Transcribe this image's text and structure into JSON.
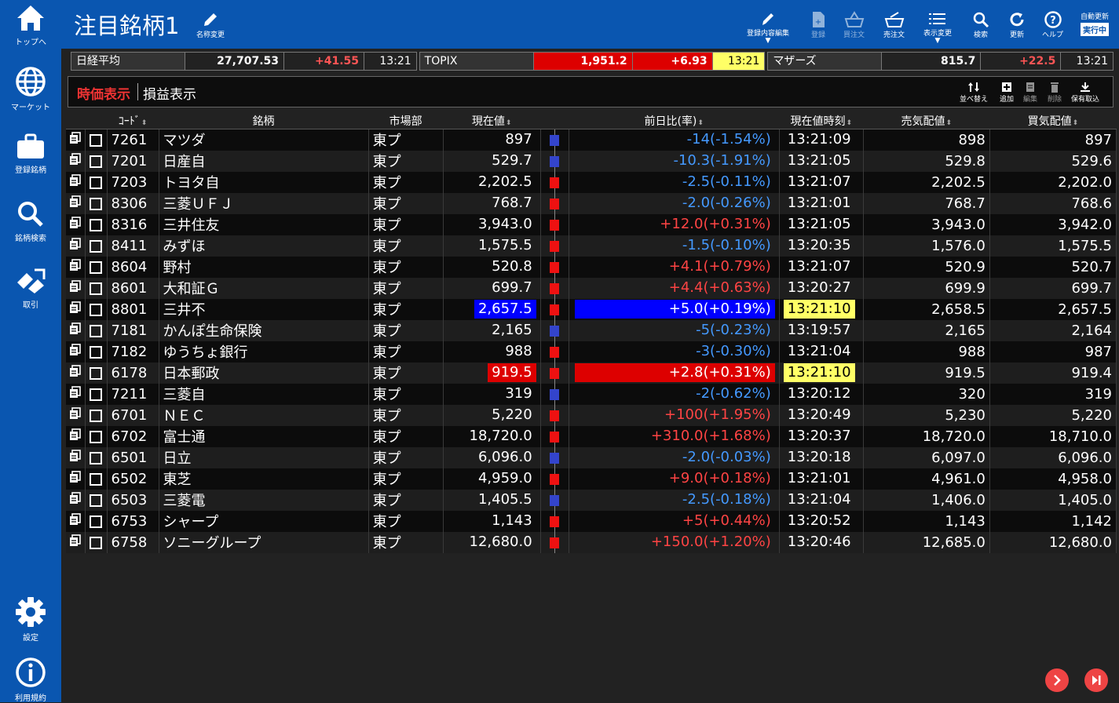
{
  "sidebar": {
    "items": [
      {
        "label": "トップへ",
        "icon": "home-icon"
      },
      {
        "label": "マーケット",
        "icon": "globe-icon"
      },
      {
        "label": "登録銘柄",
        "icon": "briefcase-icon"
      },
      {
        "label": "銘柄検索",
        "icon": "search-icon"
      },
      {
        "label": "取引",
        "icon": "trade-icon"
      },
      {
        "label": "設定",
        "icon": "gear-icon"
      },
      {
        "label": "利用規約",
        "icon": "info-icon"
      }
    ]
  },
  "header": {
    "title": "注目銘柄1",
    "rename_label": "名称変更",
    "buttons": [
      {
        "label": "登録内容編集",
        "icon": "pen-icon"
      },
      {
        "label": "登録",
        "icon": "add-doc-icon"
      },
      {
        "label": "買注文",
        "icon": "buy-basket-icon"
      },
      {
        "label": "売注文",
        "icon": "sell-basket-icon"
      },
      {
        "label": "表示変更",
        "icon": "list-icon"
      },
      {
        "label": "検索",
        "icon": "search-icon"
      },
      {
        "label": "更新",
        "icon": "refresh-icon"
      },
      {
        "label": "ヘルプ",
        "icon": "help-icon"
      }
    ],
    "auto_update_label": "自動更新",
    "auto_update_status": "実行中"
  },
  "indices": [
    {
      "name": "日経平均",
      "price": "27,707.53",
      "change": "+41.55",
      "time": "13:21"
    },
    {
      "name": "TOPIX",
      "price": "1,951.2",
      "change": "+6.93",
      "time": "13:21"
    },
    {
      "name": "マザーズ",
      "price": "815.7",
      "change": "+22.5",
      "time": "13:21"
    }
  ],
  "tabs": {
    "active": "時価表示",
    "inactive": "損益表示"
  },
  "toolbar": [
    {
      "label": "並べ替え",
      "icon": "sort-icon"
    },
    {
      "label": "追加",
      "icon": "add-icon"
    },
    {
      "label": "編集",
      "icon": "edit-icon"
    },
    {
      "label": "削除",
      "icon": "trash-icon"
    },
    {
      "label": "保有取込",
      "icon": "download-icon"
    }
  ],
  "table": {
    "headers": {
      "code": "ｺｰﾄﾞ",
      "name": "銘柄",
      "market": "市場部",
      "price": "現在値",
      "change": "前日比(率)",
      "time": "現在値時刻",
      "ask": "売気配値",
      "bid": "買気配値"
    },
    "rows": [
      {
        "code": "7261",
        "name": "マツダ",
        "market": "東プ",
        "price": "897",
        "dir": "down",
        "change": "-14(-1.54%)",
        "time": "13:21:09",
        "ask": "898",
        "bid": "897"
      },
      {
        "code": "7201",
        "name": "日産自",
        "market": "東プ",
        "price": "529.7",
        "dir": "down",
        "change": "-10.3(-1.91%)",
        "time": "13:21:05",
        "ask": "529.8",
        "bid": "529.6"
      },
      {
        "code": "7203",
        "name": "トヨタ自",
        "market": "東プ",
        "price": "2,202.5",
        "dir": "down",
        "change": "-2.5(-0.11%)",
        "time": "13:21:07",
        "ask": "2,202.5",
        "bid": "2,202.0",
        "mark": "up"
      },
      {
        "code": "8306",
        "name": "三菱ＵＦＪ",
        "market": "東プ",
        "price": "768.7",
        "dir": "down",
        "change": "-2.0(-0.26%)",
        "time": "13:21:01",
        "ask": "768.7",
        "bid": "768.6",
        "mark": "up"
      },
      {
        "code": "8316",
        "name": "三井住友",
        "market": "東プ",
        "price": "3,943.0",
        "dir": "up",
        "change": "+12.0(+0.31%)",
        "time": "13:21:05",
        "ask": "3,943.0",
        "bid": "3,942.0"
      },
      {
        "code": "8411",
        "name": "みずほ",
        "market": "東プ",
        "price": "1,575.5",
        "dir": "down",
        "change": "-1.5(-0.10%)",
        "time": "13:20:35",
        "ask": "1,576.0",
        "bid": "1,575.5",
        "mark": "up"
      },
      {
        "code": "8604",
        "name": "野村",
        "market": "東プ",
        "price": "520.8",
        "dir": "up",
        "change": "+4.1(+0.79%)",
        "time": "13:21:07",
        "ask": "520.9",
        "bid": "520.7"
      },
      {
        "code": "8601",
        "name": "大和証Ｇ",
        "market": "東プ",
        "price": "699.7",
        "dir": "up",
        "change": "+4.4(+0.63%)",
        "time": "13:20:27",
        "ask": "699.9",
        "bid": "699.7"
      },
      {
        "code": "8801",
        "name": "三井不",
        "market": "東プ",
        "price": "2,657.5",
        "dir": "up",
        "change": "+5.0(+0.19%)",
        "time": "13:21:10",
        "ask": "2,658.5",
        "bid": "2,657.5",
        "hl": "blue"
      },
      {
        "code": "7181",
        "name": "かんぽ生命保険",
        "market": "東プ",
        "price": "2,165",
        "dir": "down",
        "change": "-5(-0.23%)",
        "time": "13:19:57",
        "ask": "2,165",
        "bid": "2,164"
      },
      {
        "code": "7182",
        "name": "ゆうちょ銀行",
        "market": "東プ",
        "price": "988",
        "dir": "down",
        "change": "-3(-0.30%)",
        "time": "13:21:04",
        "ask": "988",
        "bid": "987",
        "mark": "up"
      },
      {
        "code": "6178",
        "name": "日本郵政",
        "market": "東プ",
        "price": "919.5",
        "dir": "up",
        "change": "+2.8(+0.31%)",
        "time": "13:21:10",
        "ask": "919.5",
        "bid": "919.4",
        "hl": "red"
      },
      {
        "code": "7211",
        "name": "三菱自",
        "market": "東プ",
        "price": "319",
        "dir": "down",
        "change": "-2(-0.62%)",
        "time": "13:20:12",
        "ask": "320",
        "bid": "319"
      },
      {
        "code": "6701",
        "name": "ＮＥＣ",
        "market": "東プ",
        "price": "5,220",
        "dir": "up",
        "change": "+100(+1.95%)",
        "time": "13:20:49",
        "ask": "5,230",
        "bid": "5,220"
      },
      {
        "code": "6702",
        "name": "富士通",
        "market": "東プ",
        "price": "18,720.0",
        "dir": "up",
        "change": "+310.0(+1.68%)",
        "time": "13:20:37",
        "ask": "18,720.0",
        "bid": "18,710.0"
      },
      {
        "code": "6501",
        "name": "日立",
        "market": "東プ",
        "price": "6,096.0",
        "dir": "down",
        "change": "-2.0(-0.03%)",
        "time": "13:20:18",
        "ask": "6,097.0",
        "bid": "6,096.0"
      },
      {
        "code": "6502",
        "name": "東芝",
        "market": "東プ",
        "price": "4,959.0",
        "dir": "up",
        "change": "+9.0(+0.18%)",
        "time": "13:21:01",
        "ask": "4,961.0",
        "bid": "4,958.0"
      },
      {
        "code": "6503",
        "name": "三菱電",
        "market": "東プ",
        "price": "1,405.5",
        "dir": "down",
        "change": "-2.5(-0.18%)",
        "time": "13:21:04",
        "ask": "1,406.0",
        "bid": "1,405.0"
      },
      {
        "code": "6753",
        "name": "シャープ",
        "market": "東プ",
        "price": "1,143",
        "dir": "up",
        "change": "+5(+0.44%)",
        "time": "13:20:52",
        "ask": "1,143",
        "bid": "1,142"
      },
      {
        "code": "6758",
        "name": "ソニーグループ",
        "market": "東プ",
        "price": "12,680.0",
        "dir": "up",
        "change": "+150.0(+1.20%)",
        "time": "13:20:46",
        "ask": "12,685.0",
        "bid": "12,680.0"
      }
    ]
  },
  "colors": {
    "brand": "#0a56b0",
    "up": "#ff4444",
    "down": "#4499ff",
    "marker_up": "#ee1111",
    "marker_down": "#3344cc",
    "flash_time": "#ffff66",
    "flash_blue": "#0000ff",
    "flash_red": "#dd0000"
  },
  "footer_nav": [
    {
      "icon": "next-icon"
    },
    {
      "icon": "last-page-icon"
    }
  ]
}
